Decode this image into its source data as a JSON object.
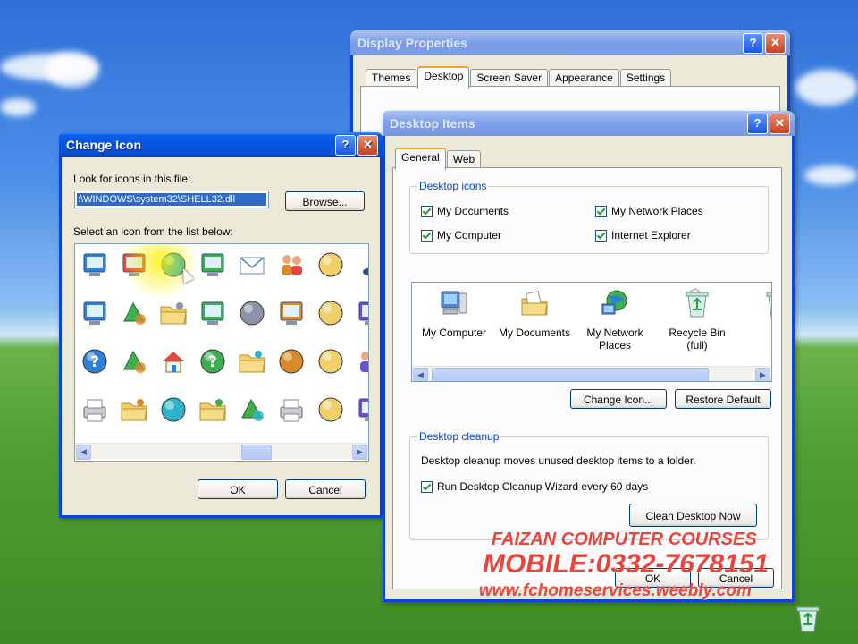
{
  "display_properties": {
    "title": "Display Properties",
    "help_label": "?",
    "close_label": "✕",
    "tabs": [
      "Themes",
      "Desktop",
      "Screen Saver",
      "Appearance",
      "Settings"
    ]
  },
  "change_icon": {
    "title": "Change Icon",
    "help_label": "?",
    "close_label": "✕",
    "look_for_label": "Look for icons in this file:",
    "file_path": ":\\WINDOWS\\system32\\SHELL32.dll",
    "browse_label": "Browse...",
    "select_label": "Select an icon from the list below:",
    "ok_label": "OK",
    "cancel_label": "Cancel",
    "icons": [
      "presentation-board-icon",
      "document-check-icon",
      "globe-icon",
      "disk-drive-icon",
      "envelope-icon",
      "users-icon",
      "network-globe-icon",
      "music-note-icon",
      "computer-network-icon",
      "recycle-icon",
      "folder-star-icon",
      "network-connection-icon",
      "clock-icon",
      "control-panel-icon",
      "gear-icon",
      "window-icon",
      "help-round-icon",
      "green-arrow-icon",
      "home-icon",
      "help-icon",
      "folder-open-icon",
      "cd-recycle-icon",
      "pie-chart-icon",
      "user-icon",
      "printer-network-icon",
      "folder-arrow-icon",
      "cd-icon",
      "folder-star-icon",
      "accessibility-icon",
      "printer-icon",
      "computer-globe-icon",
      "window-icon"
    ]
  },
  "desktop_items": {
    "title": "Desktop Items",
    "help_label": "?",
    "close_label": "✕",
    "tabs": [
      "General",
      "Web"
    ],
    "desktop_icons_label": "Desktop icons",
    "checkboxes": [
      {
        "label": "My Documents",
        "checked": true
      },
      {
        "label": "My Network Places",
        "checked": true
      },
      {
        "label": "My Computer",
        "checked": true
      },
      {
        "label": "Internet Explorer",
        "checked": true
      }
    ],
    "items": [
      {
        "label": "My Computer",
        "icon": "my-computer-icon"
      },
      {
        "label": "My Documents",
        "icon": "my-documents-icon"
      },
      {
        "label": "My Network Places",
        "icon": "my-network-places-icon"
      },
      {
        "label": "Recycle Bin (full)",
        "icon": "recycle-bin-full-icon"
      },
      {
        "label": "Re",
        "icon": "recycle-bin-empty-icon"
      }
    ],
    "change_icon_label": "Change Icon...",
    "restore_default_label": "Restore Default",
    "cleanup_label": "Desktop cleanup",
    "cleanup_desc": "Desktop cleanup moves unused desktop items to a folder.",
    "run_wizard_label": "Run Desktop Cleanup Wizard every 60 days",
    "clean_now_label": "Clean Desktop Now",
    "ok_label": "OK",
    "cancel_label": "Cancel"
  },
  "watermark": {
    "line1": "FAIZAN COMPUTER COURSES",
    "line2": "MOBILE:0332-7678151",
    "line3": "www.fchomeservices.weebly.com"
  },
  "colors": {
    "title_blue": "#0755e0",
    "window_bg": "#ece9d8",
    "group_label": "#0046d5",
    "watermark": "#e6463c"
  }
}
